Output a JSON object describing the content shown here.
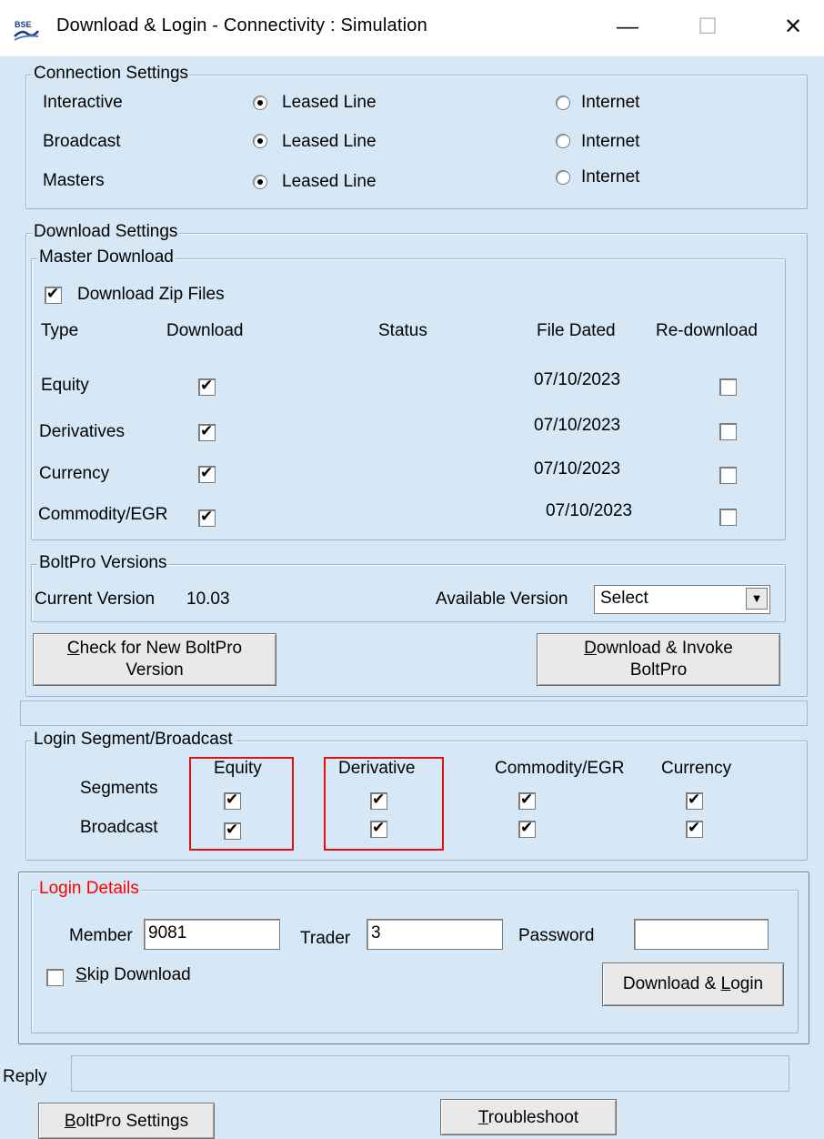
{
  "window": {
    "title": "Download & Login - Connectivity : Simulation",
    "app_icon": "bse-icon",
    "controls": {
      "minimize": "—",
      "maximize": "☐",
      "close": "✕"
    }
  },
  "connection_settings": {
    "legend": "Connection Settings",
    "rows": [
      {
        "label": "Interactive",
        "leased_line": "Leased Line",
        "internet": "Internet",
        "selected": "Leased Line"
      },
      {
        "label": "Broadcast",
        "leased_line": "Leased Line",
        "internet": "Internet",
        "selected": "Leased Line"
      },
      {
        "label": "Masters",
        "leased_line": "Leased Line",
        "internet": "Internet",
        "selected": "Leased Line"
      }
    ]
  },
  "download_settings": {
    "legend": "Download Settings",
    "master_download": {
      "legend": "Master Download",
      "download_zip_files": {
        "label": "Download Zip Files",
        "checked": true
      },
      "columns": {
        "type": "Type",
        "download": "Download",
        "status": "Status",
        "file_dated": "File Dated",
        "redownload": "Re-download"
      },
      "rows": [
        {
          "type": "Equity",
          "download": true,
          "status": "",
          "file_dated": "07/10/2023",
          "redownload": false
        },
        {
          "type": "Derivatives",
          "download": true,
          "status": "",
          "file_dated": "07/10/2023",
          "redownload": false
        },
        {
          "type": "Currency",
          "download": true,
          "status": "",
          "file_dated": "07/10/2023",
          "redownload": false
        },
        {
          "type": "Commodity/EGR",
          "download": true,
          "status": "",
          "file_dated": "07/10/2023",
          "redownload": false
        }
      ]
    },
    "boltpro_versions": {
      "legend": "BoltPro Versions",
      "current_label": "Current Version",
      "current_value": "10.03",
      "available_label": "Available Version",
      "available_value": "Select"
    },
    "check_button": {
      "line1_hotkey": "C",
      "line1_rest": "heck for New BoltPro",
      "line2": "Version"
    },
    "invoke_button": {
      "line1_hotkey": "D",
      "line1_rest": "ownload & Invoke",
      "line2": "BoltPro"
    }
  },
  "login_segment": {
    "legend": "Login Segment/Broadcast",
    "row_labels": {
      "segments": "Segments",
      "broadcast": "Broadcast"
    },
    "columns": [
      {
        "name": "Equity",
        "segments": true,
        "broadcast": true
      },
      {
        "name": "Derivative",
        "segments": true,
        "broadcast": true
      },
      {
        "name": "Commodity/EGR",
        "segments": true,
        "broadcast": true
      },
      {
        "name": "Currency",
        "segments": true,
        "broadcast": true
      }
    ],
    "highlight_color": "#e01010"
  },
  "login_details": {
    "legend": "Login Details",
    "legend_color": "#ff0000",
    "member_label": "Member",
    "member_value": "9081",
    "trader_label": "Trader",
    "trader_value": "3",
    "password_label": "Password",
    "password_value": "",
    "skip_download": {
      "hotkey": "S",
      "rest": "kip Download",
      "checked": false
    },
    "login_button": {
      "text": "Download & ",
      "hotkey": "L",
      "rest": "ogin"
    }
  },
  "reply": {
    "label": "Reply",
    "value": ""
  },
  "footer": {
    "settings_button": {
      "hotkey": "B",
      "rest": "oltPro Settings"
    },
    "troubleshoot_button": {
      "hotkey": "T",
      "rest": "roubleshoot"
    }
  }
}
